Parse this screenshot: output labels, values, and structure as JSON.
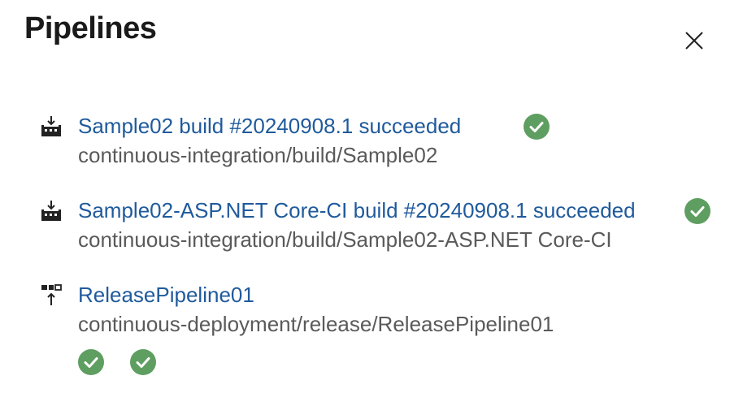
{
  "panel": {
    "title": "Pipelines",
    "close_icon": "close-icon"
  },
  "items": [
    {
      "icon": "build-pipeline-icon",
      "title": "Sample02 build #20240908.1 succeeded",
      "path": "continuous-integration/build/Sample02",
      "status": "succeeded"
    },
    {
      "icon": "build-pipeline-icon",
      "title": "Sample02-ASP.NET Core-CI build #20240908.1 succeeded",
      "path": "continuous-integration/build/Sample02-ASP.NET Core-CI",
      "status": "succeeded"
    },
    {
      "icon": "release-pipeline-icon",
      "title": "ReleasePipeline01",
      "path": "continuous-deployment/release/ReleasePipeline01",
      "stages": [
        "succeeded",
        "succeeded"
      ]
    }
  ],
  "colors": {
    "link": "#1f5a9c",
    "success": "#5f9e61",
    "subtext": "#5a5a5a"
  }
}
